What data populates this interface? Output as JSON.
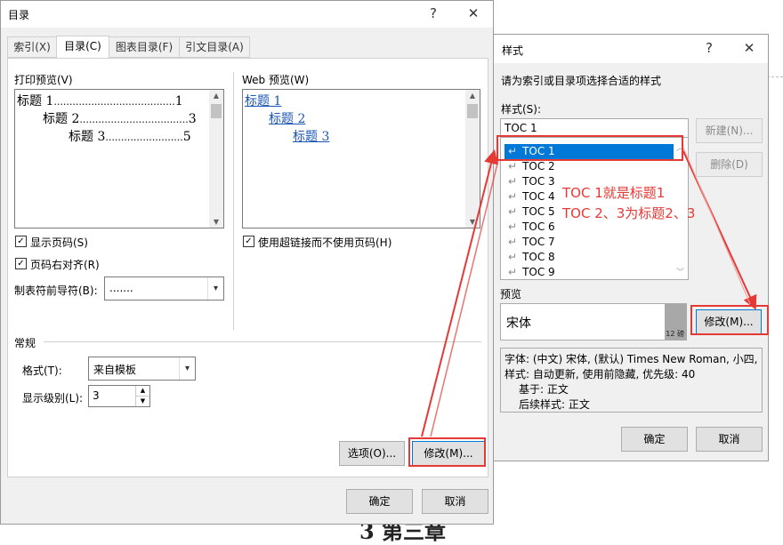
{
  "toc_dialog": {
    "title": "目录",
    "help": "?",
    "close": "✕",
    "tabs": [
      {
        "label": "索引(X)",
        "active": false
      },
      {
        "label": "目录(C)",
        "active": true
      },
      {
        "label": "图表目录(F)",
        "active": false
      },
      {
        "label": "引文目录(A)",
        "active": false
      }
    ],
    "print_preview_label": "打印预览(V)",
    "print_preview_lines": [
      {
        "text": "标题 1",
        "leader": ".......................................",
        "page": "1"
      },
      {
        "text": "标题 2",
        "leader": "...................................",
        "page": "3"
      },
      {
        "text": "标题 3",
        "leader": ".........................",
        "page": "5"
      }
    ],
    "web_preview_label": "Web 预览(W)",
    "web_preview_links": [
      "标题 1",
      "标题 2",
      "标题 3"
    ],
    "show_page_numbers": {
      "label": "显示页码(S)",
      "checked": true
    },
    "right_align_page_numbers": {
      "label": "页码右对齐(R)",
      "checked": true
    },
    "tab_leader": {
      "label": "制表符前导符(B):",
      "value": "......."
    },
    "use_hyperlinks": {
      "label": "使用超链接而不使用页码(H)",
      "checked": true
    },
    "general_label": "常规",
    "formats": {
      "label": "格式(T):",
      "value": "来自模板"
    },
    "show_levels": {
      "label": "显示级别(L):",
      "value": "3"
    },
    "options_button": "选项(O)...",
    "modify_button": "修改(M)...",
    "ok_button": "确定",
    "cancel_button": "取消"
  },
  "style_dialog": {
    "title": "样式",
    "help": "?",
    "close": "✕",
    "instruction": "请为索引或目录项选择合适的样式",
    "styles_label": "样式(S):",
    "style_input_value": "TOC 1",
    "style_list": [
      "TOC 1",
      "TOC 2",
      "TOC 3",
      "TOC 4",
      "TOC 5",
      "TOC 6",
      "TOC 7",
      "TOC 8",
      "TOC 9"
    ],
    "selected_index": 0,
    "new_button": "新建(N)...",
    "delete_button": "删除(D)",
    "preview_label": "预览",
    "preview_font": "宋体",
    "preview_size": "12 磅",
    "description_lines": [
      "字体: (中文) 宋体, (默认) Times New Roman, 小四,",
      "样式: 自动更新, 使用前隐藏, 优先级: 40",
      "基于: 正文",
      "后续样式: 正文"
    ],
    "modify_button": "修改(M)...",
    "ok_button": "确定",
    "cancel_button": "取消"
  },
  "annotation": {
    "line1": "TOC 1就是标题1",
    "line2": "TOC 2、3为标题2、3",
    "color": "#e53935"
  },
  "background_text": "3 第三章"
}
